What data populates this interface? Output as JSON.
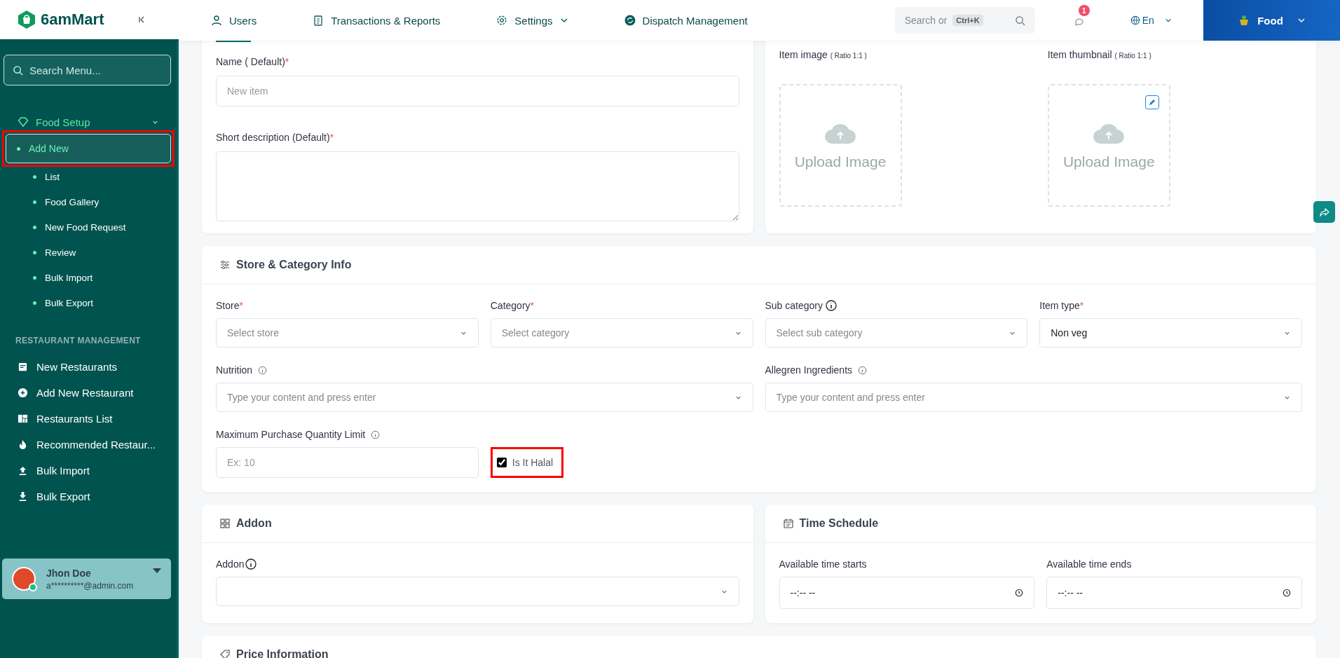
{
  "brand": {
    "name": "6amMart"
  },
  "nav": [
    {
      "label": "Users"
    },
    {
      "label": "Transactions & Reports"
    },
    {
      "label": "Settings",
      "dropdown": true
    },
    {
      "label": "Dispatch Management"
    }
  ],
  "search": {
    "placeholder": "Search or",
    "shortcut": "Ctrl+K"
  },
  "notifications": {
    "count": "1"
  },
  "language": {
    "label": "En"
  },
  "module": {
    "label": "Food"
  },
  "sidebar": {
    "search_placeholder": "Search Menu...",
    "group": {
      "label": "Food Setup",
      "expanded": true,
      "children": [
        {
          "label": "Add New",
          "selected": true,
          "highlighted": true
        },
        {
          "label": "List",
          "selected": false,
          "highlighted": false
        },
        {
          "label": "Food Gallery",
          "selected": false,
          "highlighted": false
        },
        {
          "label": "New Food Request",
          "selected": false,
          "highlighted": false
        },
        {
          "label": "Review",
          "selected": false,
          "highlighted": false
        },
        {
          "label": "Bulk Import",
          "selected": false,
          "highlighted": false
        },
        {
          "label": "Bulk Export",
          "selected": false,
          "highlighted": false
        }
      ]
    },
    "section_title": "RESTAURANT MANAGEMENT",
    "items": [
      {
        "label": "New Restaurants"
      },
      {
        "label": "Add New Restaurant"
      },
      {
        "label": "Restaurants List"
      },
      {
        "label": "Recommended Restaur..."
      },
      {
        "label": "Bulk Import"
      },
      {
        "label": "Bulk Export"
      }
    ],
    "user": {
      "name": "Jhon Doe",
      "email": "a**********@admin.com",
      "online": true
    }
  },
  "basic": {
    "fields": [
      {
        "label": "Name ( Default)",
        "required_mark": "*",
        "placeholder": "New item",
        "kind": "input"
      },
      {
        "label": "Short description (Default)",
        "required_mark": "*",
        "kind": "textarea"
      }
    ]
  },
  "images": [
    {
      "label": "Item image",
      "note": "( Ratio 1:1 )",
      "text": "Upload Image",
      "editable": false
    },
    {
      "label": "Item thumbnail",
      "note": "( Ratio 1:1 )",
      "text": "Upload Image",
      "editable": true
    }
  ],
  "store_category": {
    "title": "Store & Category Info",
    "row1": [
      {
        "label": "Store",
        "required_mark": "*",
        "placeholder": "Select store"
      },
      {
        "label": "Category",
        "required_mark": "*",
        "placeholder": "Select category"
      },
      {
        "label": "Sub category",
        "info": true,
        "placeholder": "Select sub category"
      },
      {
        "label": "Item type",
        "required_mark": "*",
        "value": "Non veg"
      }
    ],
    "row2": [
      {
        "label": "Nutrition",
        "info": true,
        "placeholder": "Type your content and press enter"
      },
      {
        "label": "Allegren Ingredients",
        "info": true,
        "placeholder": "Type your content and press enter"
      }
    ],
    "max_qty": {
      "label": "Maximum Purchase Quantity Limit",
      "info": true,
      "placeholder": "Ex: 10"
    },
    "halal": {
      "label": "Is It Halal",
      "checked": true,
      "highlighted": true
    }
  },
  "addon": {
    "title": "Addon",
    "field": {
      "label": "Addon",
      "info": true
    }
  },
  "schedule": {
    "title": "Time Schedule",
    "fields": [
      {
        "label": "Available time starts",
        "value": "--:-- --"
      },
      {
        "label": "Available time ends",
        "value": "--:-- --"
      }
    ]
  },
  "price": {
    "title": "Price Information"
  }
}
